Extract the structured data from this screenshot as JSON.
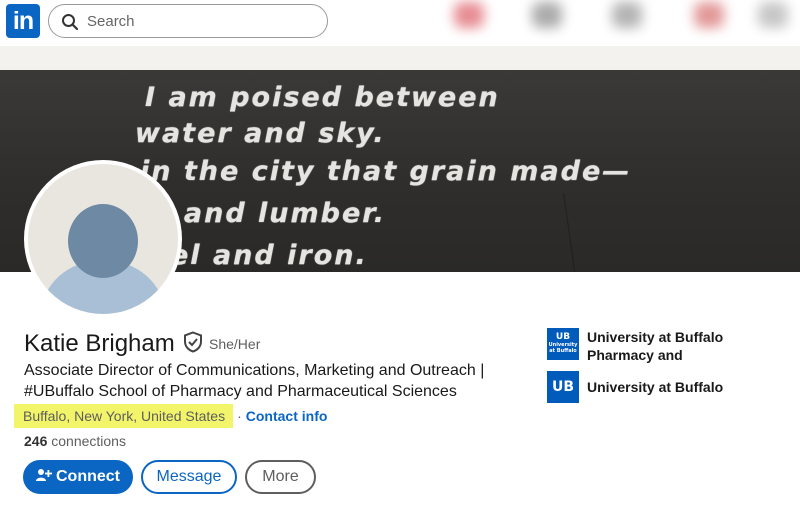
{
  "nav": {
    "logo_text": "in",
    "search_placeholder": "Search"
  },
  "banner": {
    "lines": [
      "I am poised between",
      "water and sky.",
      "in the city that grain made—",
      "in and lumber.",
      "el and iron."
    ]
  },
  "profile": {
    "name": "Katie Brigham",
    "pronouns": "She/Her",
    "headline": "Associate Director of Communications, Marketing and Outreach | #UBuffalo School of Pharmacy and Pharmaceutical Sciences",
    "location": "Buffalo, New York, United States",
    "separator": "·",
    "contact_label": "Contact info",
    "connections_count": "246",
    "connections_label": "connections",
    "highlight_color": "#f2f56a"
  },
  "actions": {
    "connect_label": "Connect",
    "message_label": "Message",
    "more_label": "More"
  },
  "organizations": [
    {
      "name": "University at Buffalo Pharmacy and Pharmaceutic…",
      "logo_icon": "ub-pharmacy-logo-icon",
      "logo_text": "University at Buffalo"
    },
    {
      "name": "University at Buffalo",
      "logo_icon": "ub-logo-icon",
      "logo_text": "UB"
    }
  ],
  "colors": {
    "brand": "#0a66c2",
    "ub_blue": "#005bbb"
  }
}
